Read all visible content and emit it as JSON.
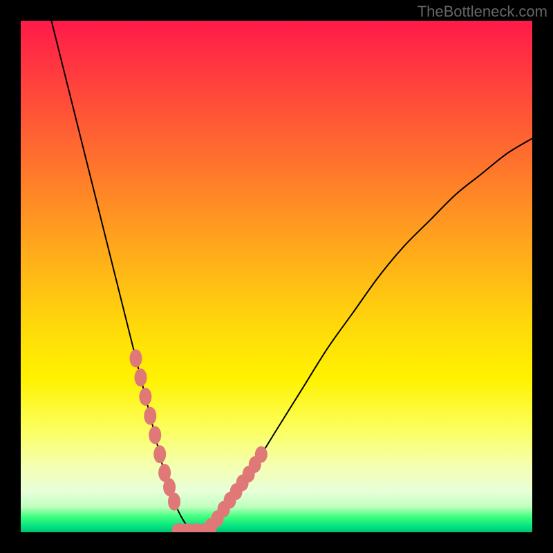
{
  "watermark": "TheBottleneck.com",
  "chart_data": {
    "type": "line",
    "title": "",
    "xlabel": "",
    "ylabel": "",
    "xlim": [
      0,
      100
    ],
    "ylim": [
      0,
      100
    ],
    "series": [
      {
        "name": "bottleneck-curve",
        "x": [
          6,
          8,
          10,
          12,
          14,
          16,
          18,
          20,
          22,
          24,
          26,
          28,
          30,
          32,
          34,
          36,
          38,
          40,
          45,
          50,
          55,
          60,
          65,
          70,
          75,
          80,
          85,
          90,
          95,
          100
        ],
        "values": [
          100,
          92,
          84,
          76,
          68,
          60,
          52,
          44,
          36,
          28,
          20,
          12,
          6,
          2,
          0,
          0,
          2,
          5,
          12,
          20,
          28,
          36,
          43,
          50,
          56,
          61,
          66,
          70,
          74,
          77
        ]
      }
    ],
    "dotted_markers": {
      "left_branch": {
        "x_start": 22.5,
        "x_end": 30,
        "y_start": 34,
        "y_end": 4
      },
      "right_branch": {
        "x_start": 36,
        "x_end": 47,
        "y_start": 2,
        "y_end": 16
      },
      "bottom": {
        "x_start": 31,
        "x_end": 36,
        "y": 0
      }
    },
    "dot_color": "#e07878",
    "curve_color": "#000000"
  }
}
